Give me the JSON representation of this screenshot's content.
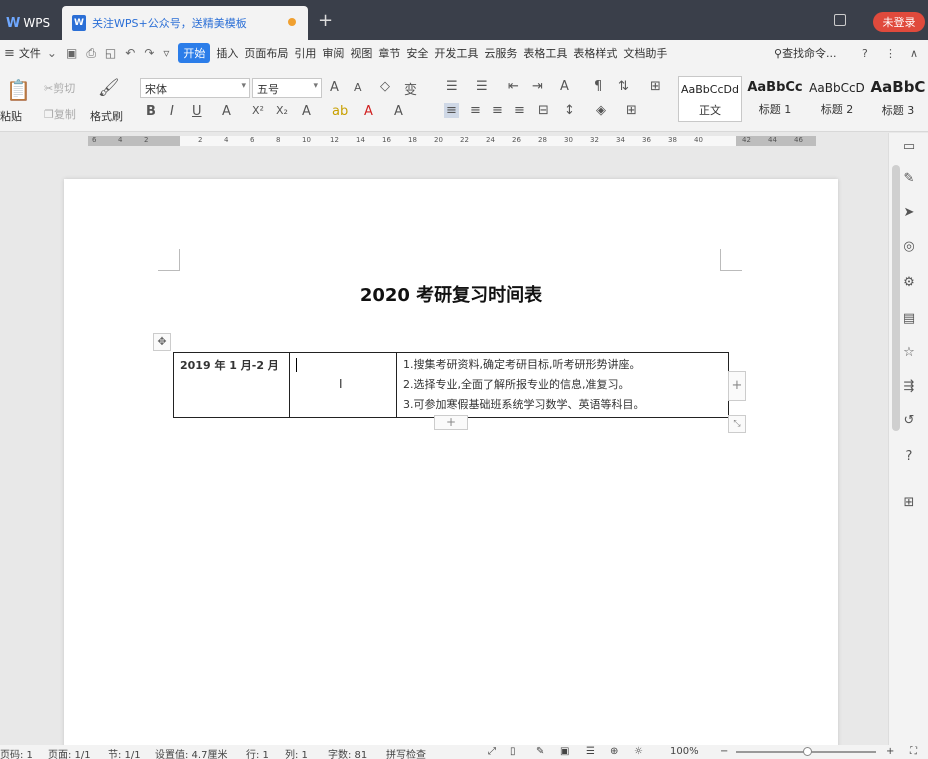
{
  "titlebar": {
    "app_name": "WPS",
    "doc_tab_title": "关注WPS+公众号，送精美模板",
    "login_label": "未登录"
  },
  "menu": {
    "file": "文件",
    "items": [
      "开始",
      "插入",
      "页面布局",
      "引用",
      "审阅",
      "视图",
      "章节",
      "安全",
      "开发工具",
      "云服务",
      "表格工具",
      "表格样式",
      "文档助手"
    ],
    "active": "开始",
    "search": "查找命令..."
  },
  "ribbon": {
    "paste": "粘贴",
    "cut": "剪切",
    "copy": "复制",
    "format_painter": "格式刷",
    "font_name": "宋体",
    "font_size": "五号",
    "styles": [
      {
        "preview": "AaBbCcDd",
        "name": "正文"
      },
      {
        "preview": "AaBbCc",
        "name": "标题 1"
      },
      {
        "preview": "AaBbCcD",
        "name": "标题 2"
      },
      {
        "preview": "AaBbC",
        "name": "标题 3"
      }
    ]
  },
  "ruler_ticks": [
    "6",
    "4",
    "2",
    "2",
    "4",
    "6",
    "8",
    "10",
    "12",
    "14",
    "16",
    "18",
    "20",
    "22",
    "24",
    "26",
    "28",
    "30",
    "32",
    "34",
    "36",
    "38",
    "40",
    "42",
    "44",
    "46"
  ],
  "document": {
    "title": "2020 考研复习时间表",
    "table": {
      "rows": [
        {
          "period": "2019 年 1 月-2 月",
          "middle": "",
          "tasks": [
            "1.搜集考研资料,确定考研目标,听考研形势讲座。",
            "2.选择专业,全面了解所报专业的信息,准复习。",
            "3.可参加寒假基础班系统学习数学、英语等科目。"
          ]
        }
      ]
    }
  },
  "statusbar": {
    "section": "页码: 1",
    "page": "页面: 1/1",
    "chapter": "节: 1/1",
    "setting": "设置值: 4.7厘米",
    "row": "行: 1",
    "col": "列: 1",
    "words": "字数: 81",
    "spellcheck": "拼写检查",
    "zoom": "100%"
  }
}
